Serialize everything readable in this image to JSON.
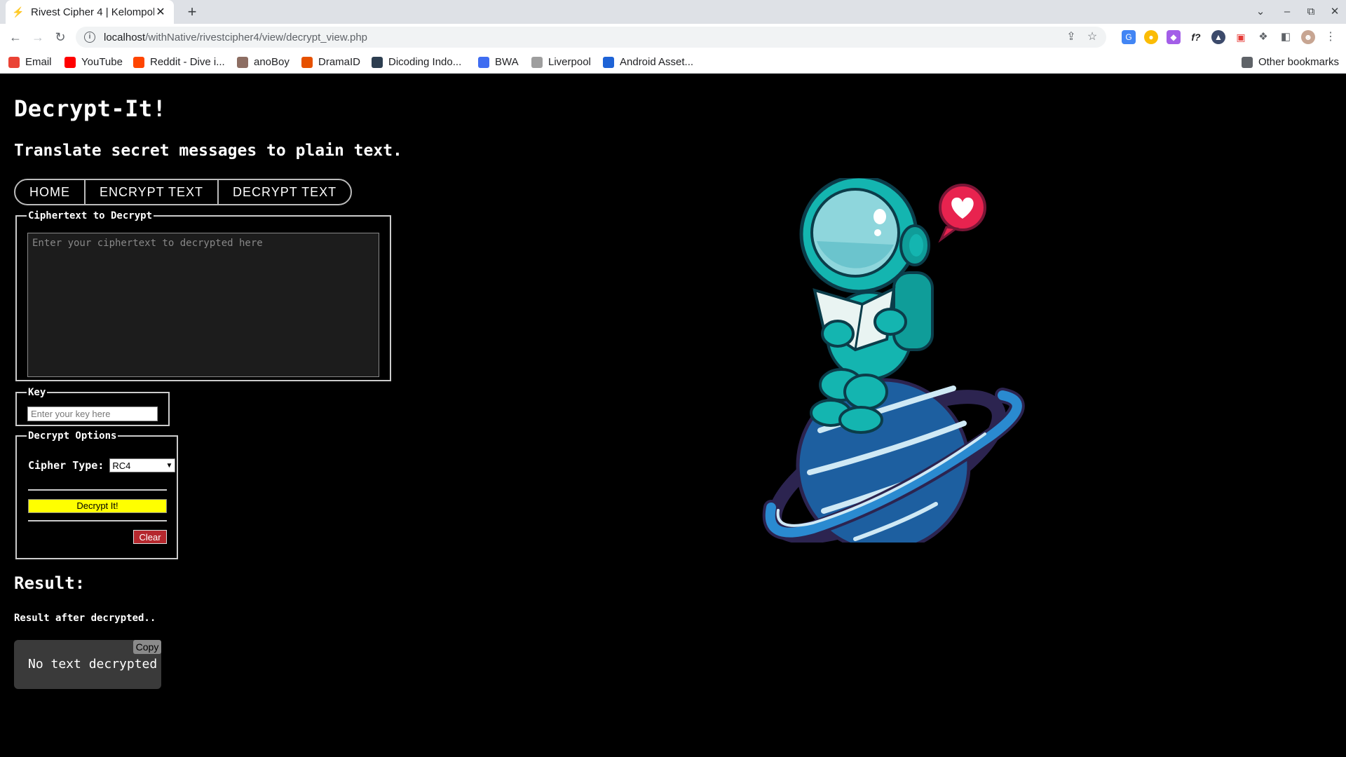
{
  "browser": {
    "tab_title": "Rivest Cipher 4 | Kelompok",
    "new_tab": "+",
    "url_host": "localhost",
    "url_path": "/withNative/rivestcipher4/view/decrypt_view.php",
    "bookmarks": [
      {
        "label": "Email",
        "icon": "gmail-icon",
        "color": "#ea4335"
      },
      {
        "label": "YouTube",
        "icon": "youtube-icon",
        "color": "#ff0000"
      },
      {
        "label": "Reddit - Dive i...",
        "icon": "reddit-icon",
        "color": "#ff4500"
      },
      {
        "label": "anoBoy",
        "icon": "anoboy-icon",
        "color": "#8d6e63"
      },
      {
        "label": "DramaID",
        "icon": "dramaid-icon",
        "color": "#e65100"
      },
      {
        "label": "Dicoding Indo...",
        "icon": "dicoding-icon",
        "color": "#2d3e50"
      },
      {
        "label": "BWA",
        "icon": "bwa-icon",
        "color": "#3f6df1"
      },
      {
        "label": "Liverpool",
        "icon": "liverpool-icon",
        "color": "#9e9e9e"
      },
      {
        "label": "Android Asset...",
        "icon": "android-asset-icon",
        "color": "#1e63d6"
      }
    ],
    "other_bookmarks": "Other bookmarks"
  },
  "page": {
    "title": "Decrypt-It!",
    "subtitle": "Translate secret messages to plain text.",
    "nav": [
      "HOME",
      "ENCRYPT TEXT",
      "DECRYPT TEXT"
    ],
    "cipher_legend": "Ciphertext to Decrypt",
    "cipher_placeholder": "Enter your ciphertext to decrypted here",
    "key_legend": "Key",
    "key_placeholder": "Enter your key here",
    "options_legend": "Decrypt Options",
    "cipher_type_label": "Cipher Type:",
    "cipher_type_value": "RC4",
    "decrypt_button": "Decrypt It!",
    "clear_button": "Clear",
    "result_heading": "Result:",
    "result_desc": "Result after decrypted..",
    "result_text": "No text decrypted",
    "copy_button": "Copy"
  },
  "colors": {
    "decrypt_button": "#ffff00",
    "clear_button": "#b5282e",
    "astronaut": "#14b5b0",
    "planet": "#1d5fa0",
    "heart_bubble": "#e8234f"
  }
}
